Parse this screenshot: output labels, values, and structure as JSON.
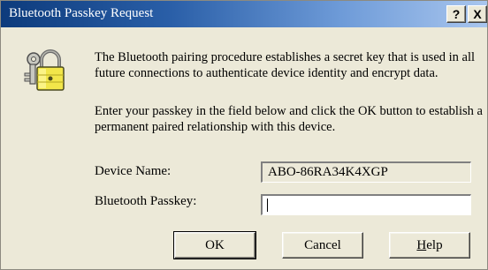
{
  "window": {
    "title": "Bluetooth Passkey Request",
    "help_glyph": "?",
    "close_glyph": "X"
  },
  "icon": {
    "name": "lock-with-keys-icon"
  },
  "description": {
    "paragraph1": "The Bluetooth pairing procedure establishes a secret key that is used in all future connections to authenticate device identity and encrypt data.",
    "paragraph2": "Enter your passkey in the field below and click the OK button to establish a permanent paired relationship with this device."
  },
  "fields": {
    "device_name_label": "Device Name:",
    "device_name_value": "ABO-86RA34K4XGP",
    "passkey_label": "Bluetooth Passkey:",
    "passkey_value": ""
  },
  "buttons": {
    "ok": "OK",
    "cancel": "Cancel",
    "help_first": "H",
    "help_rest": "elp"
  }
}
